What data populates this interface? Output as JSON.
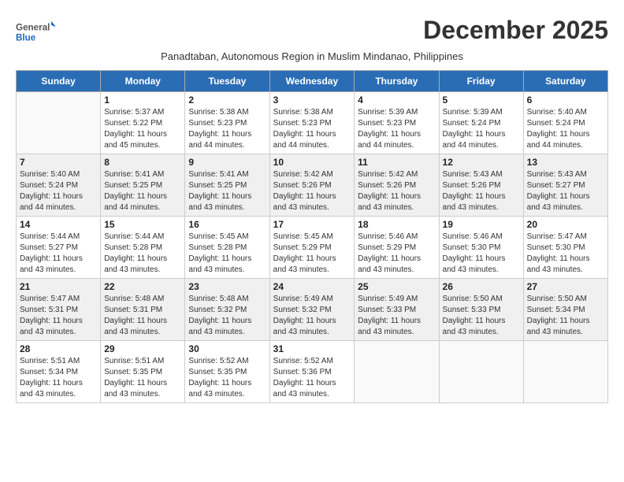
{
  "logo": {
    "general": "General",
    "blue": "Blue"
  },
  "title": "December 2025",
  "subtitle": "Panadtaban, Autonomous Region in Muslim Mindanao, Philippines",
  "days_of_week": [
    "Sunday",
    "Monday",
    "Tuesday",
    "Wednesday",
    "Thursday",
    "Friday",
    "Saturday"
  ],
  "weeks": [
    [
      {
        "day": "",
        "info": ""
      },
      {
        "day": "1",
        "info": "Sunrise: 5:37 AM\nSunset: 5:22 PM\nDaylight: 11 hours\nand 45 minutes."
      },
      {
        "day": "2",
        "info": "Sunrise: 5:38 AM\nSunset: 5:23 PM\nDaylight: 11 hours\nand 44 minutes."
      },
      {
        "day": "3",
        "info": "Sunrise: 5:38 AM\nSunset: 5:23 PM\nDaylight: 11 hours\nand 44 minutes."
      },
      {
        "day": "4",
        "info": "Sunrise: 5:39 AM\nSunset: 5:23 PM\nDaylight: 11 hours\nand 44 minutes."
      },
      {
        "day": "5",
        "info": "Sunrise: 5:39 AM\nSunset: 5:24 PM\nDaylight: 11 hours\nand 44 minutes."
      },
      {
        "day": "6",
        "info": "Sunrise: 5:40 AM\nSunset: 5:24 PM\nDaylight: 11 hours\nand 44 minutes."
      }
    ],
    [
      {
        "day": "7",
        "info": "Sunrise: 5:40 AM\nSunset: 5:24 PM\nDaylight: 11 hours\nand 44 minutes."
      },
      {
        "day": "8",
        "info": "Sunrise: 5:41 AM\nSunset: 5:25 PM\nDaylight: 11 hours\nand 44 minutes."
      },
      {
        "day": "9",
        "info": "Sunrise: 5:41 AM\nSunset: 5:25 PM\nDaylight: 11 hours\nand 43 minutes."
      },
      {
        "day": "10",
        "info": "Sunrise: 5:42 AM\nSunset: 5:26 PM\nDaylight: 11 hours\nand 43 minutes."
      },
      {
        "day": "11",
        "info": "Sunrise: 5:42 AM\nSunset: 5:26 PM\nDaylight: 11 hours\nand 43 minutes."
      },
      {
        "day": "12",
        "info": "Sunrise: 5:43 AM\nSunset: 5:26 PM\nDaylight: 11 hours\nand 43 minutes."
      },
      {
        "day": "13",
        "info": "Sunrise: 5:43 AM\nSunset: 5:27 PM\nDaylight: 11 hours\nand 43 minutes."
      }
    ],
    [
      {
        "day": "14",
        "info": "Sunrise: 5:44 AM\nSunset: 5:27 PM\nDaylight: 11 hours\nand 43 minutes."
      },
      {
        "day": "15",
        "info": "Sunrise: 5:44 AM\nSunset: 5:28 PM\nDaylight: 11 hours\nand 43 minutes."
      },
      {
        "day": "16",
        "info": "Sunrise: 5:45 AM\nSunset: 5:28 PM\nDaylight: 11 hours\nand 43 minutes."
      },
      {
        "day": "17",
        "info": "Sunrise: 5:45 AM\nSunset: 5:29 PM\nDaylight: 11 hours\nand 43 minutes."
      },
      {
        "day": "18",
        "info": "Sunrise: 5:46 AM\nSunset: 5:29 PM\nDaylight: 11 hours\nand 43 minutes."
      },
      {
        "day": "19",
        "info": "Sunrise: 5:46 AM\nSunset: 5:30 PM\nDaylight: 11 hours\nand 43 minutes."
      },
      {
        "day": "20",
        "info": "Sunrise: 5:47 AM\nSunset: 5:30 PM\nDaylight: 11 hours\nand 43 minutes."
      }
    ],
    [
      {
        "day": "21",
        "info": "Sunrise: 5:47 AM\nSunset: 5:31 PM\nDaylight: 11 hours\nand 43 minutes."
      },
      {
        "day": "22",
        "info": "Sunrise: 5:48 AM\nSunset: 5:31 PM\nDaylight: 11 hours\nand 43 minutes."
      },
      {
        "day": "23",
        "info": "Sunrise: 5:48 AM\nSunset: 5:32 PM\nDaylight: 11 hours\nand 43 minutes."
      },
      {
        "day": "24",
        "info": "Sunrise: 5:49 AM\nSunset: 5:32 PM\nDaylight: 11 hours\nand 43 minutes."
      },
      {
        "day": "25",
        "info": "Sunrise: 5:49 AM\nSunset: 5:33 PM\nDaylight: 11 hours\nand 43 minutes."
      },
      {
        "day": "26",
        "info": "Sunrise: 5:50 AM\nSunset: 5:33 PM\nDaylight: 11 hours\nand 43 minutes."
      },
      {
        "day": "27",
        "info": "Sunrise: 5:50 AM\nSunset: 5:34 PM\nDaylight: 11 hours\nand 43 minutes."
      }
    ],
    [
      {
        "day": "28",
        "info": "Sunrise: 5:51 AM\nSunset: 5:34 PM\nDaylight: 11 hours\nand 43 minutes."
      },
      {
        "day": "29",
        "info": "Sunrise: 5:51 AM\nSunset: 5:35 PM\nDaylight: 11 hours\nand 43 minutes."
      },
      {
        "day": "30",
        "info": "Sunrise: 5:52 AM\nSunset: 5:35 PM\nDaylight: 11 hours\nand 43 minutes."
      },
      {
        "day": "31",
        "info": "Sunrise: 5:52 AM\nSunset: 5:36 PM\nDaylight: 11 hours\nand 43 minutes."
      },
      {
        "day": "",
        "info": ""
      },
      {
        "day": "",
        "info": ""
      },
      {
        "day": "",
        "info": ""
      }
    ]
  ]
}
